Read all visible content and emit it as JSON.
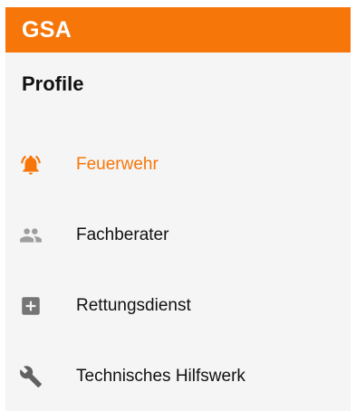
{
  "appbar": {
    "title": "GSA",
    "background": "#f7760a"
  },
  "drawer": {
    "section_title": "Profile",
    "items": [
      {
        "label": "Feuerwehr",
        "icon": "alarm-bell-icon",
        "active": true,
        "color": "#f7760a"
      },
      {
        "label": "Fachberater",
        "icon": "people-icon",
        "active": false,
        "color": "#9e9e9e"
      },
      {
        "label": "Rettungsdienst",
        "icon": "medical-plus-icon",
        "active": false,
        "color": "#757575"
      },
      {
        "label": "Technisches Hilfswerk",
        "icon": "wrench-icon",
        "active": false,
        "color": "#616161"
      }
    ]
  }
}
